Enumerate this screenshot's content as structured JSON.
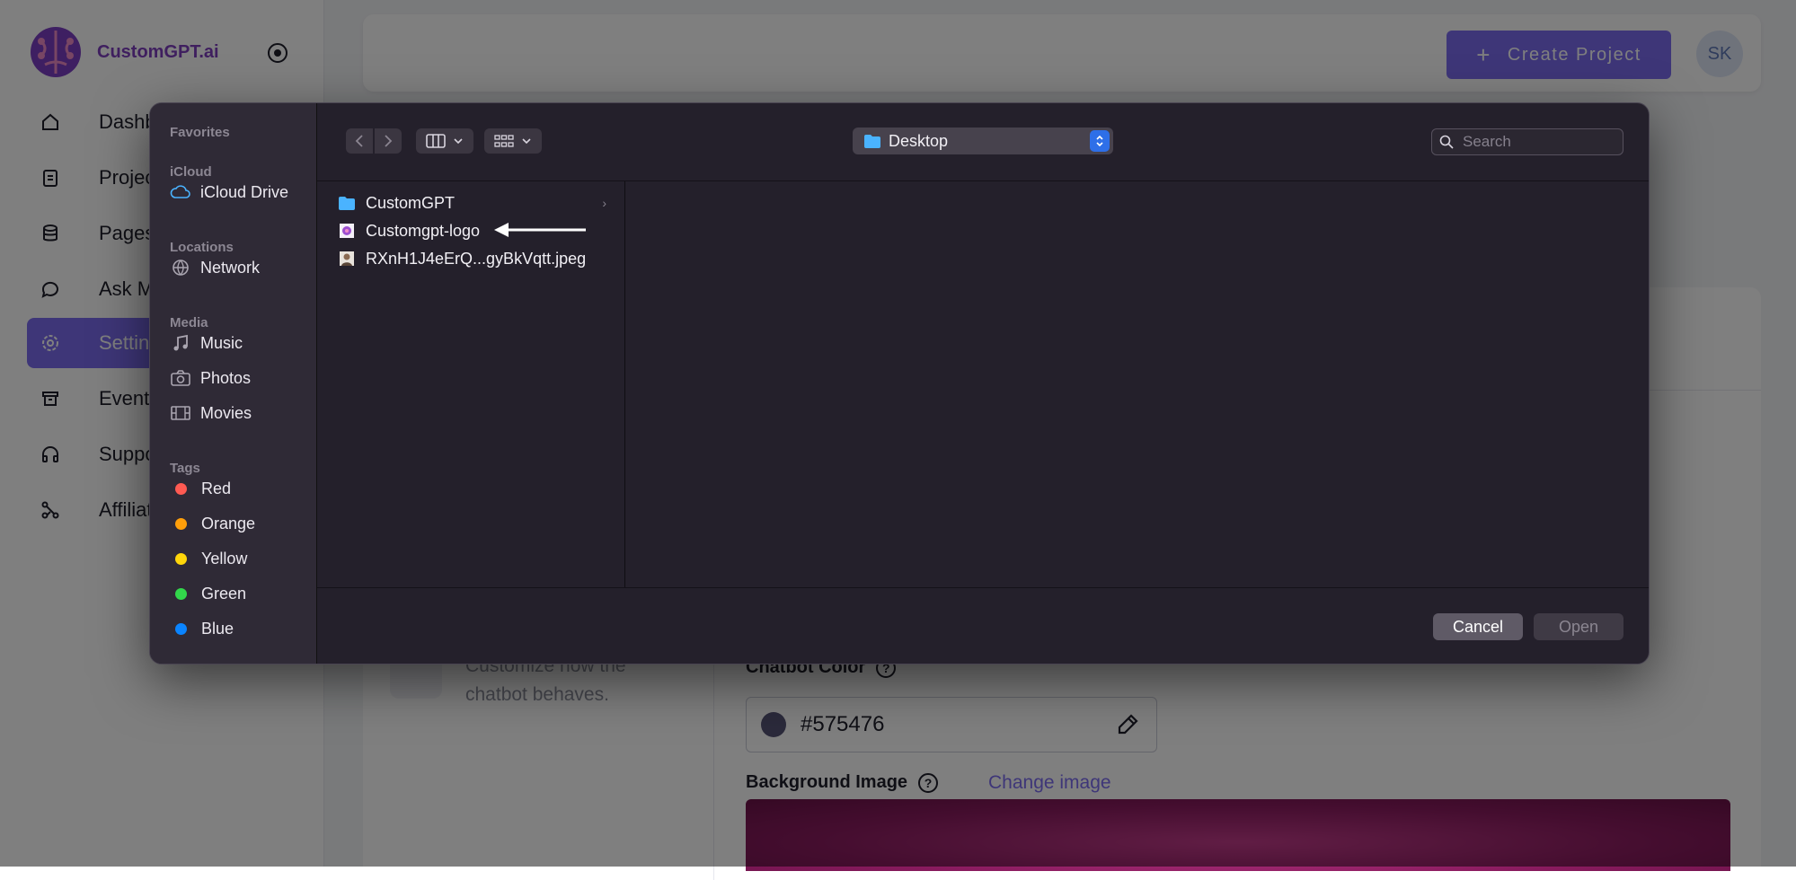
{
  "app": {
    "brand_name": "CustomGPT.ai",
    "nav": [
      {
        "label": "Dashboard",
        "icon": "home-icon"
      },
      {
        "label": "Projects",
        "icon": "clipboard-icon"
      },
      {
        "label": "Pages",
        "icon": "database-icon"
      },
      {
        "label": "Ask Me Anything",
        "icon": "chat-bubble-icon"
      },
      {
        "label": "Settings",
        "icon": "gear-icon",
        "active": true
      },
      {
        "label": "Events",
        "icon": "archive-icon"
      },
      {
        "label": "Support",
        "icon": "headphones-icon"
      },
      {
        "label": "Affiliate",
        "icon": "share-icon"
      }
    ],
    "topbar": {
      "create_project_label": "Create Project",
      "avatar_initials": "SK"
    },
    "persona": {
      "description": "Customize how the chatbot behaves."
    },
    "chatbot_color": {
      "label": "Chatbot Color",
      "value": "#575476",
      "swatch": "#575476"
    },
    "background_image": {
      "label": "Background Image",
      "change_link": "Change image"
    }
  },
  "dialog": {
    "sidebar": {
      "favorites_header": "Favorites",
      "icloud_header": "iCloud",
      "icloud_drive": "iCloud Drive",
      "locations_header": "Locations",
      "network": "Network",
      "media_header": "Media",
      "music": "Music",
      "photos": "Photos",
      "movies": "Movies",
      "tags_header": "Tags",
      "tags": [
        {
          "label": "Red",
          "color": "#ff5a52"
        },
        {
          "label": "Orange",
          "color": "#ff9f0a"
        },
        {
          "label": "Yellow",
          "color": "#ffd60a"
        },
        {
          "label": "Green",
          "color": "#32d74b"
        },
        {
          "label": "Blue",
          "color": "#0a84ff"
        }
      ]
    },
    "toolbar": {
      "location": "Desktop",
      "search_placeholder": "Search"
    },
    "files": [
      {
        "name": "CustomGPT",
        "type": "folder"
      },
      {
        "name": "Customgpt-logo",
        "type": "image"
      },
      {
        "name": "RXnH1J4eErQ...gyBkVqtt.jpeg",
        "type": "photo"
      }
    ],
    "buttons": {
      "cancel": "Cancel",
      "open": "Open"
    }
  }
}
